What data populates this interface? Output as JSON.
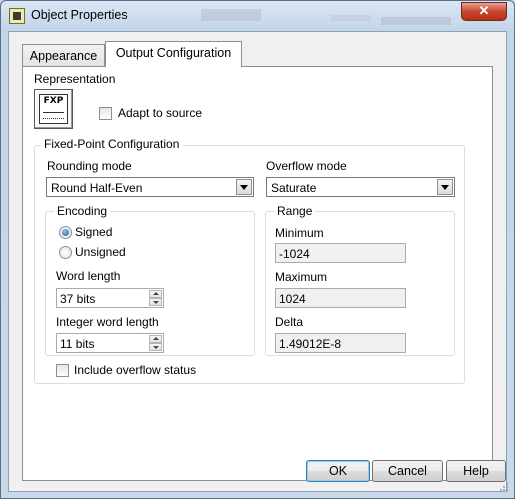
{
  "window": {
    "title": "Object Properties",
    "close_glyph": "✕",
    "app_icon": "labview-vi-icon"
  },
  "tabs": [
    {
      "label": "Appearance",
      "selected": false
    },
    {
      "label": "Output Configuration",
      "selected": true
    }
  ],
  "representation": {
    "label": "Representation",
    "icon_text": "FXP",
    "adapt_label": "Adapt to source",
    "adapt_checked": false
  },
  "fixed_point": {
    "legend": "Fixed-Point Configuration",
    "rounding_label": "Rounding mode",
    "rounding_value": "Round Half-Even",
    "overflow_label": "Overflow mode",
    "overflow_value": "Saturate",
    "encoding": {
      "legend": "Encoding",
      "signed_label": "Signed",
      "unsigned_label": "Unsigned",
      "selected": "Signed",
      "word_length_label": "Word length",
      "word_length_value": "37 bits",
      "integer_word_length_label": "Integer word length",
      "integer_word_length_value": "11 bits"
    },
    "range": {
      "legend": "Range",
      "minimum_label": "Minimum",
      "minimum_value": "-1024",
      "maximum_label": "Maximum",
      "maximum_value": "1024",
      "delta_label": "Delta",
      "delta_value": "1.49012E-8"
    },
    "overflow_status_label": "Include overflow status",
    "overflow_status_checked": false
  },
  "buttons": {
    "ok": "OK",
    "cancel": "Cancel",
    "help": "Help"
  },
  "colors": {
    "frame": "#c3d5e8",
    "close_button": "#c9452f",
    "selected_radio": "#1c5a9c",
    "default_button_border": "#3c7fb1"
  }
}
